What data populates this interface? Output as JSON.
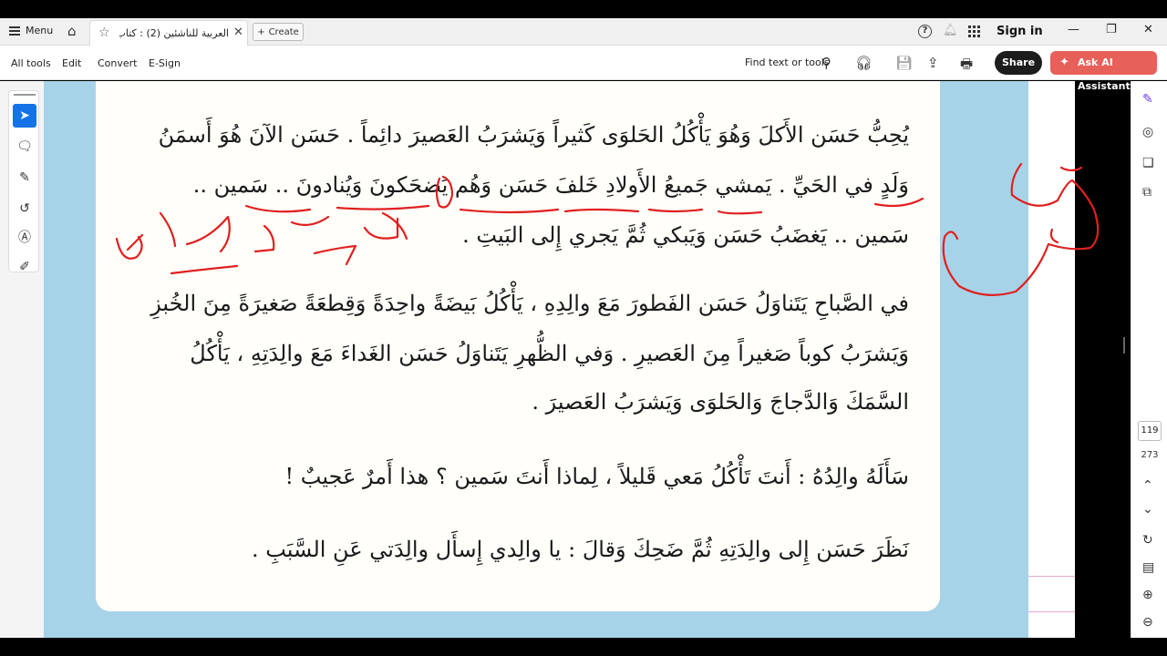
{
  "tabbar": {
    "menu_label": "Menu",
    "tab_title": "العربية للناشئين (2) : كتاب ا...",
    "create_label": "Create",
    "signin_label": "Sign in"
  },
  "toolbar": {
    "all_tools": "All tools",
    "edit": "Edit",
    "convert": "Convert",
    "esign": "E-Sign",
    "find": "Find text or tools",
    "share": "Share",
    "ask_ai": "Ask AI Assistant"
  },
  "document": {
    "p1": [
      "يُحِبُّ حَسَن الأَكلَ وَهُوَ يَأْكُلُ الحَلوَى كَثيراً وَيَشرَبُ العَصيرَ دائِماً . حَسَن الآنَ هُوَ أَسمَنُ",
      "وَلَدٍ في الحَيِّ . يَمشي جَميعُ الأَولادِ خَلفَ حَسَن وَهُم يَضحَكونَ وَيُنادونَ .. سَمين ..",
      "سَمين .. يَغضَبُ حَسَن وَيَبكي ثُمَّ يَجري إِلى البَيتِ ."
    ],
    "p2": [
      "في الصَّباحِ يَتَناوَلُ حَسَن الفَطورَ مَعَ والِدِهِ ، يَأْكُلُ بَيضَةً واحِدَةً وَقِطعَةً صَغيرَةً مِنَ الخُبزِ",
      "وَيَشرَبُ كوباً صَغيراً مِنَ العَصيرِ . وَفي الظُّهرِ يَتَناوَلُ حَسَن الغَداءَ مَعَ والِدَتِهِ ، يَأْكُلُ",
      "السَّمَكَ وَالدَّجاجَ وَالحَلوَى وَيَشرَبُ العَصيرَ ."
    ],
    "p3": "سَأَلَهُ والِدُهُ : أَنتَ تَأْكُلُ مَعي قَليلاً ، لِماذا أَنتَ سَمين ؟ هذا أَمرٌ عَجيبٌ !",
    "p4": "نَظَرَ حَسَن إِلى والِدَتِهِ ثُمَّ ضَحِكَ وَقالَ : يا والِدي إِسأَل والِدَتي عَنِ السَّبَبِ ."
  },
  "page_nav": {
    "current": "119",
    "total": "273"
  },
  "icons": {
    "hamburger": "menu-icon",
    "home": "home-icon",
    "star": "star-icon",
    "close": "close-icon",
    "plus": "plus-icon",
    "help": "help-icon",
    "bell": "bell-icon",
    "apps": "apps-grid-icon",
    "search": "search-icon",
    "audio": "headphones-icon",
    "save": "save-icon",
    "upload": "upload-icon",
    "print": "print-icon",
    "select": "cursor-icon",
    "comment": "comment-icon",
    "draw": "pen-icon",
    "lasso": "lasso-icon",
    "text": "text-box-icon",
    "stamp": "stamp-icon"
  },
  "colors": {
    "page_border_blue": "#a7d3e8",
    "annotation_red": "#e0201f",
    "share_bg": "#1d1d1d",
    "ask_ai_bg": "#e8605a",
    "active_tool": "#1473e6"
  }
}
